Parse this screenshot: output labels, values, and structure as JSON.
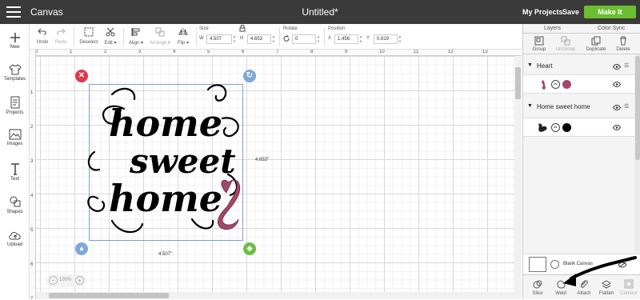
{
  "header": {
    "app_title": "Canvas",
    "doc_title": "Untitled*",
    "my_projects": "My Projects",
    "save": "Save",
    "make_it": "Make It"
  },
  "left_panel": {
    "items": [
      {
        "label": "New",
        "icon": "plus-icon"
      },
      {
        "label": "Templates",
        "icon": "shirt-icon"
      },
      {
        "label": "Projects",
        "icon": "projects-icon"
      },
      {
        "label": "Images",
        "icon": "image-icon"
      },
      {
        "label": "Text",
        "icon": "text-icon"
      },
      {
        "label": "Shapes",
        "icon": "shapes-icon"
      },
      {
        "label": "Upload",
        "icon": "cloud-upload-icon"
      }
    ]
  },
  "toolbar": {
    "undo": "Undo",
    "redo": "Redo",
    "deselect": "Deselect",
    "edit": "Edit",
    "align": "Align",
    "arrange": "Arrange",
    "flip": "Flip",
    "size_label": "Size",
    "w_label": "W",
    "w_value": "4.507",
    "h_label": "H",
    "h_value": "4.653",
    "rotate_label": "Rotate",
    "rotate_value": "0",
    "position_label": "Position",
    "x_label": "X",
    "x_value": "1.456",
    "y_label": "Y",
    "y_value": "0.819"
  },
  "canvas": {
    "ruler_top": [
      "0",
      "1",
      "2",
      "3",
      "4",
      "5",
      "6",
      "7",
      "8",
      "9",
      "10",
      "11",
      "12",
      "13"
    ],
    "ruler_left": [
      "1",
      "2",
      "3",
      "4",
      "5",
      "6",
      "7"
    ],
    "height_dim": "4.653\"",
    "width_dim": "4.507\"",
    "zoom": "100%",
    "design_text": [
      "home",
      "sweet",
      "home"
    ],
    "colors": {
      "selection": "#7b9fd6",
      "delete_handle": "#d93a4f",
      "rotate_handle": "#7fa7dc",
      "lock_handle": "#7fa7dc",
      "scale_handle": "#6bbe45",
      "heart": "#a24868"
    }
  },
  "right_panel": {
    "tabs": [
      "Layers",
      "Color Sync"
    ],
    "actions": [
      {
        "label": "Group",
        "enabled": true
      },
      {
        "label": "UnGroup",
        "enabled": false
      },
      {
        "label": "Duplicate",
        "enabled": true
      },
      {
        "label": "Delete",
        "enabled": true
      }
    ],
    "groups": [
      {
        "name": "Heart",
        "color": "#a24868"
      },
      {
        "name": "Home sweet home",
        "color": "#000000"
      }
    ],
    "blank_canvas": "Blank Canvas",
    "bottom_actions": [
      {
        "label": "Slice",
        "enabled": true
      },
      {
        "label": "Weld",
        "enabled": true
      },
      {
        "label": "Attach",
        "enabled": true
      },
      {
        "label": "Flatten",
        "enabled": true
      },
      {
        "label": "Contour",
        "enabled": false
      }
    ]
  }
}
